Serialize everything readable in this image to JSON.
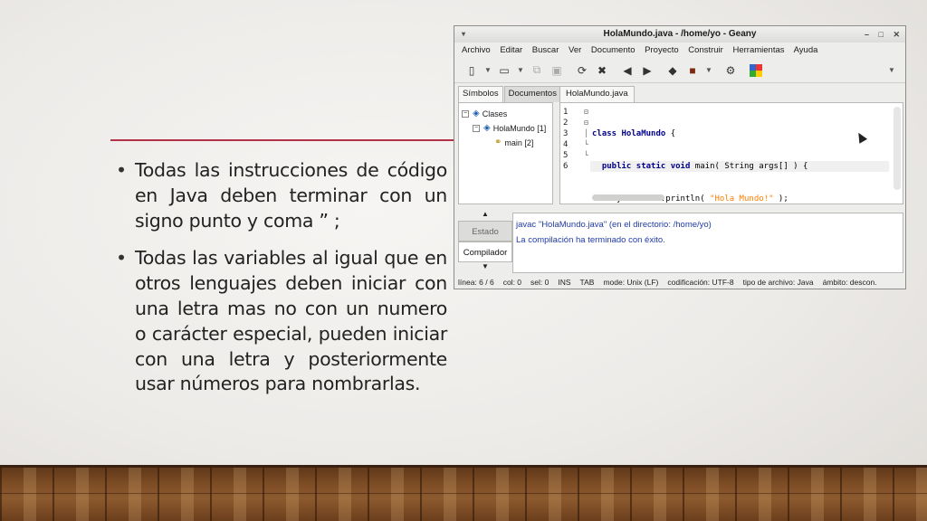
{
  "slide": {
    "bullets": [
      "Todas las instrucciones de código en Java deben terminar con un signo punto y coma ” ;",
      "Todas las variables al igual que en otros lenguajes deben iniciar con una letra mas no con un numero o carácter especial, pueden iniciar con una letra y posteriormente usar números para nombrarlas."
    ],
    "accent_color": "#b3324a"
  },
  "window": {
    "title": "HolaMundo.java - /home/yo - Geany",
    "buttons": {
      "minimize": "–",
      "maximize": "□",
      "close": "✕"
    }
  },
  "menu": [
    "Archivo",
    "Editar",
    "Buscar",
    "Ver",
    "Documento",
    "Proyecto",
    "Construir",
    "Herramientas",
    "Ayuda"
  ],
  "toolbar": {
    "icons": [
      "new-file-icon",
      "open-file-icon",
      "revert-icon",
      "save-all-icon",
      "reload-icon",
      "close-icon",
      "back-icon",
      "forward-icon",
      "compile-icon",
      "build-icon",
      "preferences-icon",
      "color-chooser-icon"
    ]
  },
  "sidebar": {
    "tabs": [
      "Símbolos",
      "Documentos"
    ],
    "tree": [
      {
        "label": "Clases"
      },
      {
        "label": "HolaMundo [1]"
      },
      {
        "label": "main [2]"
      }
    ]
  },
  "editor": {
    "tab": "HolaMundo.java",
    "line_numbers": [
      "1",
      "2",
      "3",
      "4",
      "5",
      "6"
    ],
    "code": {
      "l1_kw": "class",
      "l1_name": "HolaMundo",
      "l1_rest": " {",
      "l2_indent": "  ",
      "l2_kw": "public static void",
      "l2_rest": " main( String args[] ) {",
      "l3_pre": "    System.out.println( ",
      "l3_str": "\"Hola Mundo!\"",
      "l3_post": " );",
      "l4": "  }",
      "l5": "}",
      "l6": ""
    }
  },
  "messages": {
    "tabs": [
      "Estado",
      "Compilador"
    ],
    "lines": [
      "javac \"HolaMundo.java\" (en el directorio: /home/yo)",
      "La compilación ha terminado con éxito."
    ]
  },
  "statusbar": [
    "línea: 6 / 6",
    "col: 0",
    "sel: 0",
    "INS",
    "TAB",
    "mode: Unix (LF)",
    "codificación: UTF-8",
    "tipo de archivo: Java",
    "ámbito: descon."
  ]
}
